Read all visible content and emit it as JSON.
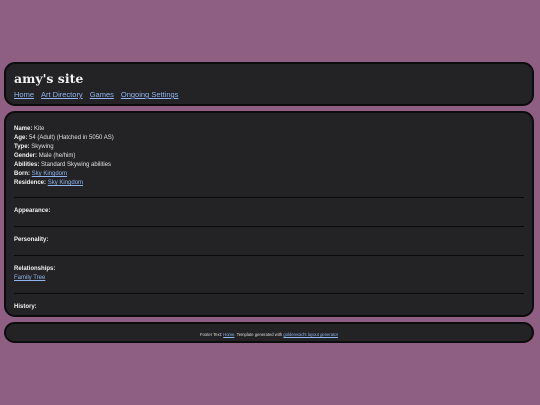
{
  "header": {
    "title": "amy's site",
    "nav": [
      "Home",
      "Art Directory",
      "Games",
      "Ongoing Settings"
    ]
  },
  "profile": {
    "name_label": "Name:",
    "name_value": "Kite",
    "age_label": "Age:",
    "age_value": "54 (Adult) (Hatched in 5050 AS)",
    "type_label": "Type:",
    "type_value": "Skywing",
    "gender_label": "Gender:",
    "gender_value": "Male (he/him)",
    "abilities_label": "Abilities:",
    "abilities_value": "Standard Skywing abilities",
    "born_label": "Born:",
    "born_value": "Sky Kingdom",
    "residence_label": "Residence:",
    "residence_value": "Sky Kingdom"
  },
  "sections": {
    "appearance": "Appearance:",
    "personality": "Personality:",
    "relationships": "Relationships:",
    "relationships_link": "Family Tree",
    "history": "History:"
  },
  "footer": {
    "prefix": "Footer Text: ",
    "home_link": "Home",
    "middle": ". Template generated with ",
    "generator_link": "goldenvoid's layout generator"
  },
  "colors": {
    "background": "#8e5e83",
    "panel": "#232325",
    "link": "#8fb4f0"
  }
}
